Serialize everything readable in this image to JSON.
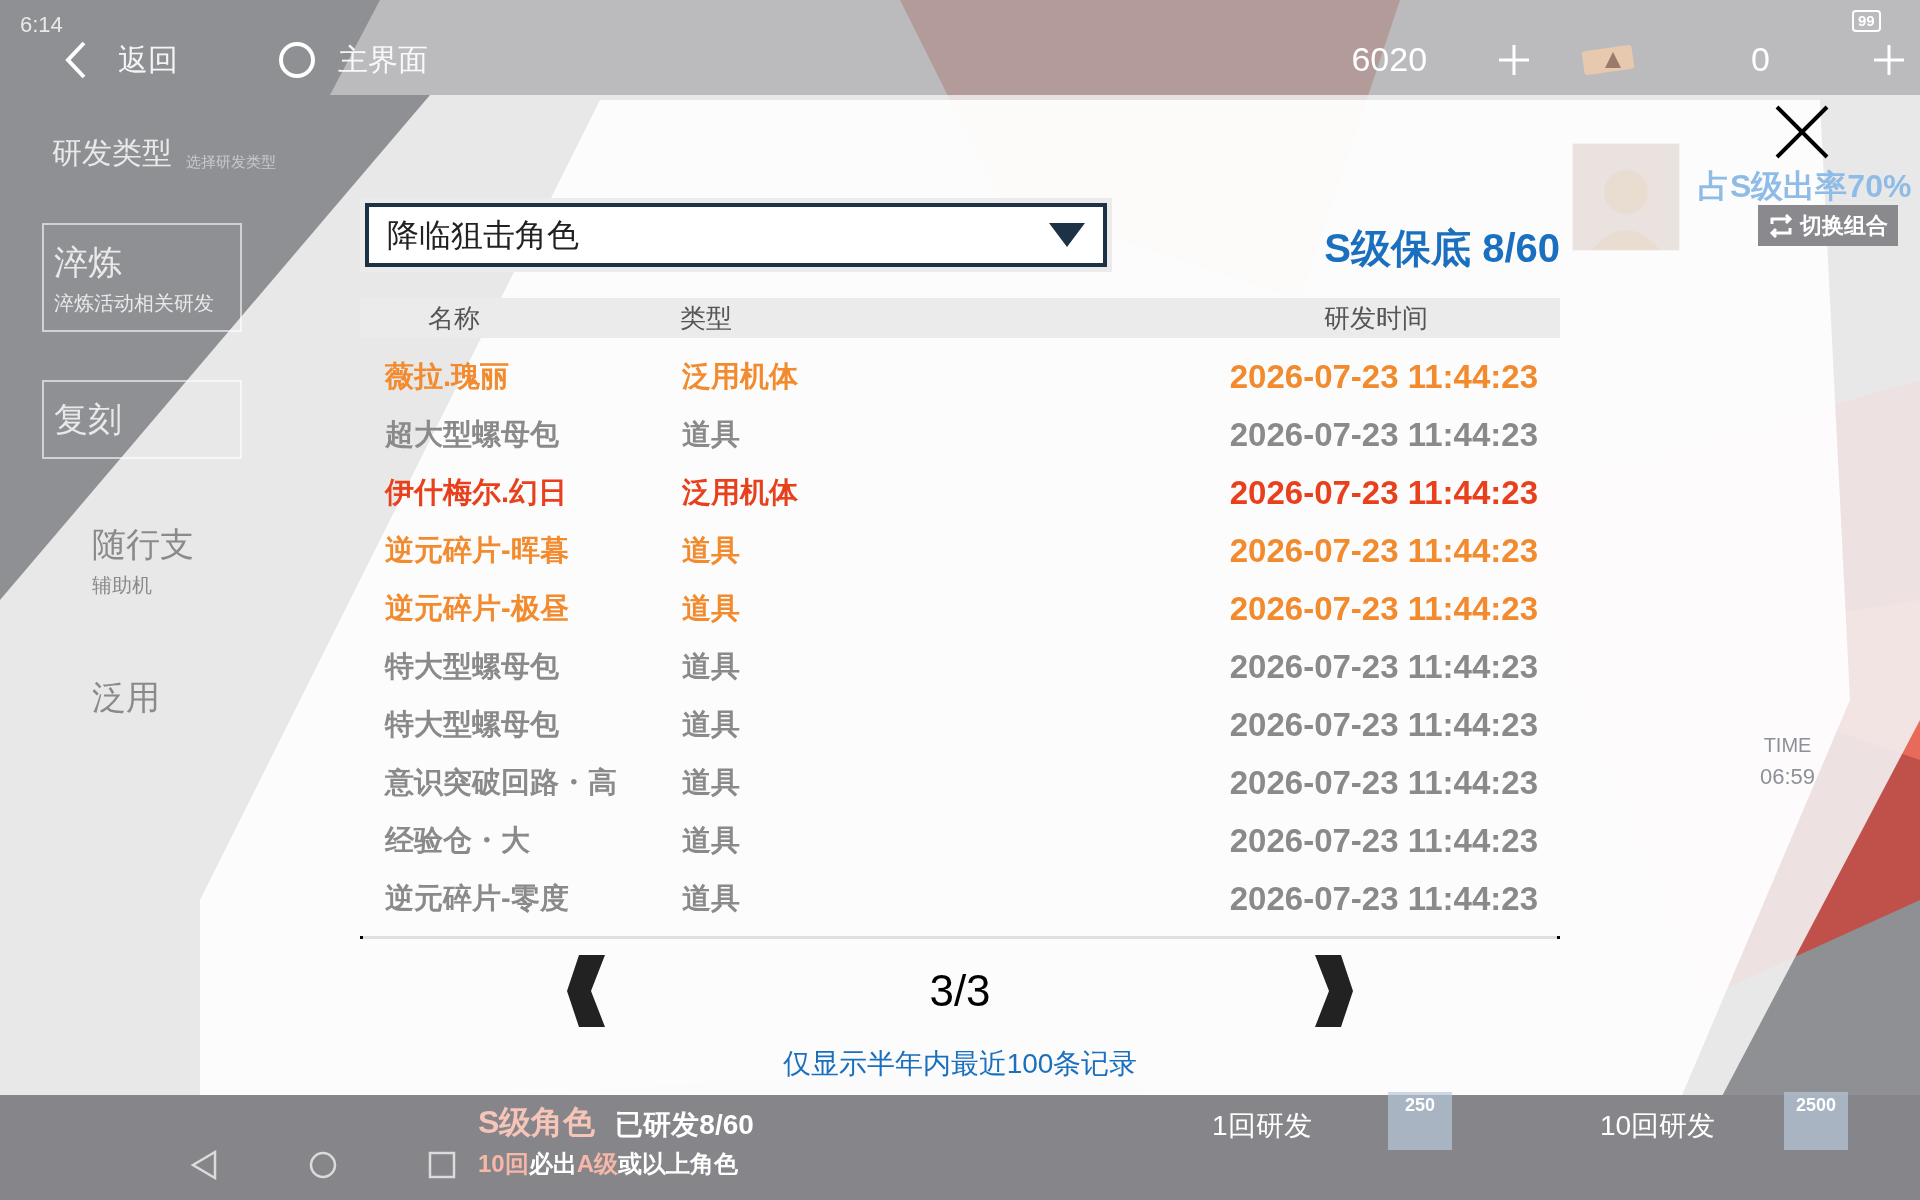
{
  "status_bar": {
    "time": "6:14",
    "battery": "99"
  },
  "top_bar": {
    "back": "返回",
    "home": "主界面",
    "currency": "6020",
    "tickets": "0"
  },
  "side_menu": {
    "title": "研发类型",
    "subtitle": "选择研发类型",
    "items": [
      {
        "title": "淬炼",
        "subtitle": "淬炼活动相关研发"
      },
      {
        "title": "复刻"
      },
      {
        "title": "随行支",
        "subtitle": "辅助机"
      },
      {
        "title": "泛用"
      }
    ]
  },
  "right_panel": {
    "rate": "占S级出率70%",
    "switch": "切换组合",
    "timer_label": "TIME",
    "timer": "06:59"
  },
  "bottom_bar": {
    "rank": "S级角色",
    "progress": "已研发8/60",
    "rule": [
      {
        "text": "10回",
        "color": "#f7b7a8"
      },
      {
        "text": "必出",
        "color": "#ffffff"
      },
      {
        "text": "A级",
        "color": "#f7b7a8"
      },
      {
        "text": "或以上角色",
        "color": "#ffffff"
      }
    ],
    "single": "1回研发",
    "single_cost": "250",
    "ten": "10回研发",
    "ten_cost": "2500"
  },
  "dialog": {
    "pool": "降临狙击角色",
    "pity": "S级保底 8/60",
    "columns": [
      "名称",
      "类型",
      "研发时间"
    ],
    "rows": [
      {
        "name": "薇拉.瑰丽",
        "type": "泛用机体",
        "time": "2026-07-23 11:44:23",
        "color": "#f28a2e"
      },
      {
        "name": "超大型螺母包",
        "type": "道具",
        "time": "2026-07-23 11:44:23",
        "color": "#8a8a8a"
      },
      {
        "name": "伊什梅尔.幻日",
        "type": "泛用机体",
        "time": "2026-07-23 11:44:23",
        "color": "#e8401c"
      },
      {
        "name": "逆元碎片-晖暮",
        "type": "道具",
        "time": "2026-07-23 11:44:23",
        "color": "#f28a2e"
      },
      {
        "name": "逆元碎片-极昼",
        "type": "道具",
        "time": "2026-07-23 11:44:23",
        "color": "#f28a2e"
      },
      {
        "name": "特大型螺母包",
        "type": "道具",
        "time": "2026-07-23 11:44:23",
        "color": "#8a8a8a"
      },
      {
        "name": "特大型螺母包",
        "type": "道具",
        "time": "2026-07-23 11:44:23",
        "color": "#8a8a8a"
      },
      {
        "name": "意识突破回路・高",
        "type": "道具",
        "time": "2026-07-23 11:44:23",
        "color": "#8a8a8a"
      },
      {
        "name": "经验仓・大",
        "type": "道具",
        "time": "2026-07-23 11:44:23",
        "color": "#8a8a8a"
      },
      {
        "name": "逆元碎片-零度",
        "type": "道具",
        "time": "2026-07-23 11:44:23",
        "color": "#8a8a8a"
      }
    ],
    "page": "3/3",
    "note": "仅显示半年内最近100条记录"
  }
}
